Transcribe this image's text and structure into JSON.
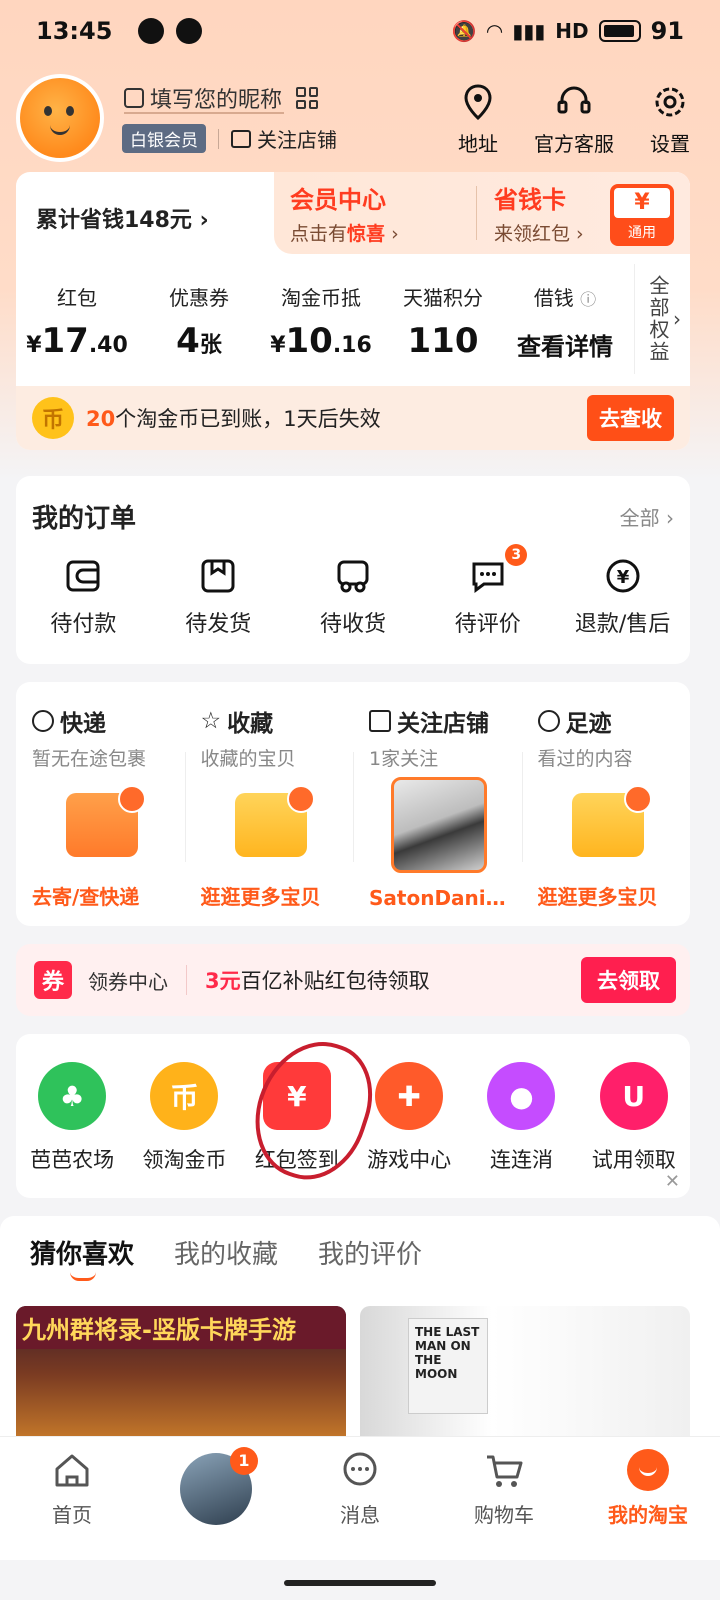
{
  "status": {
    "time": "13:45",
    "battery": "91",
    "network": "HD"
  },
  "profile": {
    "nickname": "填写您的昵称",
    "member_level": "白银会员",
    "follow_shop": "关注店铺"
  },
  "top_actions": [
    {
      "label": "地址",
      "icon": "location-icon"
    },
    {
      "label": "官方客服",
      "icon": "headset-icon"
    },
    {
      "label": "设置",
      "icon": "gear-icon"
    }
  ],
  "savings": {
    "total_saved": "累计省钱148元",
    "vip_title": "会员中心",
    "vip_sub_prefix": "点击有",
    "vip_sub_highlight": "惊喜",
    "card_title": "省钱卡",
    "card_sub": "来领红包",
    "coupon_symbol": "¥",
    "coupon_tag": "通用"
  },
  "assets": [
    {
      "label": "红包",
      "prefix": "¥",
      "value": "17",
      "decimal": ".40"
    },
    {
      "label": "优惠券",
      "prefix": "",
      "value": "4",
      "decimal": "张"
    },
    {
      "label": "淘金币抵",
      "prefix": "¥",
      "value": "10",
      "decimal": ".16"
    },
    {
      "label": "天猫积分",
      "prefix": "",
      "value": "110",
      "decimal": ""
    },
    {
      "label": "借钱",
      "prefix": "",
      "value": "查看详情",
      "decimal": ""
    }
  ],
  "all_rights": "全部权益",
  "coin_bar": {
    "icon_text": "币",
    "count": "20",
    "message": "个淘金币已到账，1天后失效",
    "button": "去查收"
  },
  "orders": {
    "title": "我的订单",
    "all": "全部",
    "items": [
      {
        "label": "待付款",
        "icon": "wallet-icon"
      },
      {
        "label": "待发货",
        "icon": "package-icon"
      },
      {
        "label": "待收货",
        "icon": "truck-icon"
      },
      {
        "label": "待评价",
        "icon": "comment-icon",
        "badge": "3"
      },
      {
        "label": "退款/售后",
        "icon": "refund-icon"
      }
    ]
  },
  "logistics": [
    {
      "title": "快递",
      "sub": "暂无在途包裹",
      "link": "去寄/查快递"
    },
    {
      "title": "收藏",
      "sub": "收藏的宝贝",
      "link": "逛逛更多宝贝"
    },
    {
      "title": "关注店铺",
      "sub": "1家关注",
      "link": "SatonDanie..."
    },
    {
      "title": "足迹",
      "sub": "看过的内容",
      "link": "逛逛更多宝贝"
    }
  ],
  "coupon_center": {
    "icon_text": "券",
    "label": "领券中心",
    "amount": "3元",
    "message": "百亿补贴红包待领取",
    "button": "去领取"
  },
  "apps": [
    {
      "label": "芭芭农场",
      "color": "#2fc25b",
      "glyph": "♣"
    },
    {
      "label": "领淘金币",
      "color": "#ffb21a",
      "glyph": "币"
    },
    {
      "label": "红包签到",
      "color": "#ff3a3a",
      "glyph": "¥"
    },
    {
      "label": "游戏中心",
      "color": "#ff5a2a",
      "glyph": "✚"
    },
    {
      "label": "连连消",
      "color": "#c54cff",
      "glyph": "●"
    },
    {
      "label": "试用领取",
      "color": "#ff1f6a",
      "glyph": "U"
    }
  ],
  "guess": {
    "tabs": [
      "猜你喜欢",
      "我的收藏",
      "我的评价"
    ],
    "banner": "九州群将录-竖版卡牌手游",
    "poster": "THE LAST MAN ON THE MOON"
  },
  "bottom_nav": [
    {
      "label": "首页",
      "icon": "home-icon"
    },
    {
      "label": "",
      "icon": "avatar",
      "badge": "1"
    },
    {
      "label": "消息",
      "icon": "chat-icon"
    },
    {
      "label": "购物车",
      "icon": "cart-icon"
    },
    {
      "label": "我的淘宝",
      "icon": "me-icon"
    }
  ]
}
